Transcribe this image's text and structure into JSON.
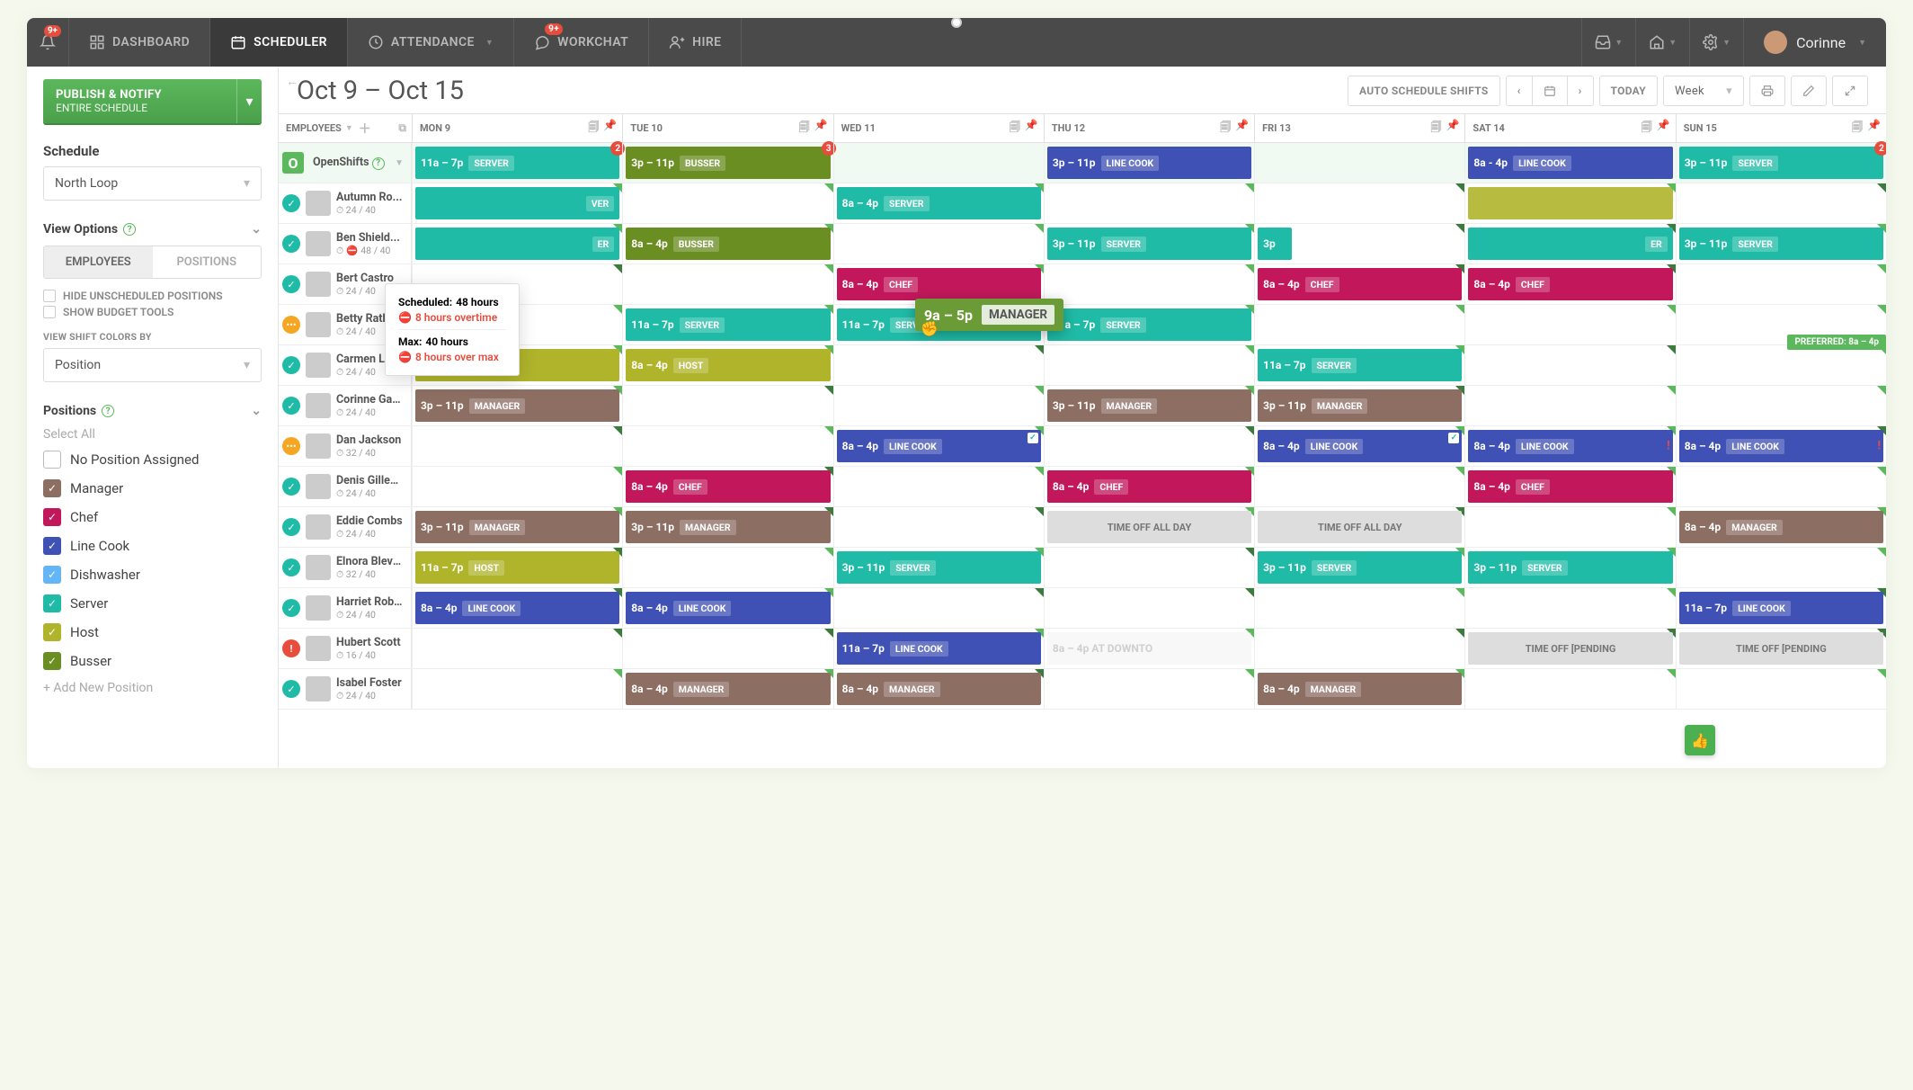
{
  "nav": {
    "notif_badge": "9+",
    "dashboard": "DASHBOARD",
    "scheduler": "SCHEDULER",
    "attendance": "ATTENDANCE",
    "workchat": "WORKCHAT",
    "workchat_badge": "9+",
    "hire": "HIRE",
    "user": "Corinne"
  },
  "sidebar": {
    "publish_title": "PUBLISH & NOTIFY",
    "publish_sub": "ENTIRE SCHEDULE",
    "schedule_label": "Schedule",
    "schedule_value": "North Loop",
    "view_options": "View Options",
    "toggle_a": "EMPLOYEES",
    "toggle_b": "POSITIONS",
    "hide_unscheduled": "HIDE UNSCHEDULED POSITIONS",
    "show_budget": "SHOW BUDGET TOOLS",
    "view_colors_by": "VIEW SHIFT COLORS BY",
    "color_value": "Position",
    "positions_label": "Positions",
    "select_all": "Select All",
    "positions": [
      {
        "label": "No Position Assigned",
        "color": "#fff",
        "border": "#bbb",
        "checked": false
      },
      {
        "label": "Manager",
        "color": "#8d6e63",
        "checked": true
      },
      {
        "label": "Chef",
        "color": "#c2185b",
        "checked": true
      },
      {
        "label": "Line Cook",
        "color": "#3f51b5",
        "checked": true
      },
      {
        "label": "Dishwasher",
        "color": "#64b5f6",
        "checked": true
      },
      {
        "label": "Server",
        "color": "#1fbba6",
        "checked": true
      },
      {
        "label": "Host",
        "color": "#afb42b",
        "checked": true
      },
      {
        "label": "Busser",
        "color": "#6b8e23",
        "checked": true
      }
    ],
    "add_position": "+ Add New Position"
  },
  "toolbar": {
    "date_range": "Oct 9 – Oct 15",
    "auto_schedule": "AUTO SCHEDULE SHIFTS",
    "today": "TODAY",
    "view": "Week"
  },
  "grid": {
    "employees_hdr": "EMPLOYEES",
    "days": [
      "MON 9",
      "TUE 10",
      "WED 11",
      "THU 12",
      "FRI 13",
      "SAT 14",
      "SUN 15"
    ],
    "openshifts_label": "OpenShifts",
    "openshifts": [
      {
        "day": 0,
        "time": "11a – 7p",
        "role": "SERVER",
        "color": "#1fbba6",
        "count": "2"
      },
      {
        "day": 1,
        "time": "3p – 11p",
        "role": "BUSSER",
        "color": "#6b8e23",
        "count": "3"
      },
      {
        "day": 3,
        "time": "3p – 11p",
        "role": "LINE COOK",
        "color": "#3f51b5"
      },
      {
        "day": 5,
        "time": "8a - 4p",
        "role": "LINE COOK",
        "color": "#3f51b5"
      },
      {
        "day": 6,
        "time": "3p – 11p",
        "role": "SERVER",
        "color": "#1fbba6",
        "count": "2"
      }
    ],
    "rows": [
      {
        "name": "Autumn Ro...",
        "hours": "24 / 40",
        "status": "ok",
        "shifts": [
          {
            "day": 0,
            "time": "",
            "role": "VER",
            "color": "#1fbba6",
            "partial": true
          },
          {
            "day": 2,
            "time": "8a – 4p",
            "role": "SERVER",
            "color": "#1fbba6"
          }
        ]
      },
      {
        "name": "Ben Shield...",
        "hours": "48 / 40",
        "status": "ok",
        "warn": true,
        "shifts": [
          {
            "day": 0,
            "time": "",
            "role": "ER",
            "color": "#1fbba6",
            "partial": true
          },
          {
            "day": 1,
            "time": "8a – 4p",
            "role": "BUSSER",
            "color": "#6b8e23"
          },
          {
            "day": 3,
            "time": "3p – 11p",
            "role": "SERVER",
            "color": "#1fbba6"
          },
          {
            "day": 4,
            "time": "3p",
            "role": "",
            "color": "#1fbba6",
            "narrow": true
          },
          {
            "day": 5,
            "time": "",
            "role": "ER",
            "color": "#1fbba6",
            "partial": true
          },
          {
            "day": 6,
            "time": "3p – 11p",
            "role": "SERVER",
            "color": "#1fbba6"
          }
        ]
      },
      {
        "name": "Bert Castro",
        "hours": "24 / 40",
        "status": "ok",
        "shifts": [
          {
            "day": 2,
            "time": "8a – 4p",
            "role": "CHEF",
            "color": "#c2185b"
          },
          {
            "day": 4,
            "time": "8a – 4p",
            "role": "CHEF",
            "color": "#c2185b"
          },
          {
            "day": 5,
            "time": "8a – 4p",
            "role": "CHEF",
            "color": "#c2185b"
          }
        ]
      },
      {
        "name": "Betty Rathmen",
        "hours": "24 / 40",
        "status": "warn",
        "shifts": [
          {
            "day": 1,
            "time": "11a – 7p",
            "role": "SERVER",
            "color": "#1fbba6"
          },
          {
            "day": 2,
            "time": "11a – 7p",
            "role": "SERVER",
            "color": "#1fbba6"
          },
          {
            "day": 3,
            "time": "11a – 7p",
            "role": "SERVER",
            "color": "#1fbba6"
          }
        ]
      },
      {
        "name": "Carmen Lowe",
        "hours": "24 / 40",
        "status": "ok",
        "pref": "PREFERRED: 8a – 4p",
        "shifts": [
          {
            "day": 0,
            "time": "8a – 4p",
            "role": "HOST",
            "color": "#afb42b"
          },
          {
            "day": 1,
            "time": "8a – 4p",
            "role": "HOST",
            "color": "#afb42b"
          },
          {
            "day": 4,
            "time": "11a – 7p",
            "role": "SERVER",
            "color": "#1fbba6"
          }
        ]
      },
      {
        "name": "Corinne Garris...",
        "hours": "24 / 40",
        "status": "ok",
        "shifts": [
          {
            "day": 0,
            "time": "3p – 11p",
            "role": "MANAGER",
            "color": "#8d6e63"
          },
          {
            "day": 3,
            "time": "3p – 11p",
            "role": "MANAGER",
            "color": "#8d6e63"
          },
          {
            "day": 4,
            "time": "3p – 11p",
            "role": "MANAGER",
            "color": "#8d6e63"
          }
        ]
      },
      {
        "name": "Dan Jackson",
        "hours": "32 / 40",
        "status": "warn",
        "shifts": [
          {
            "day": 2,
            "time": "8a – 4p",
            "role": "LINE COOK",
            "color": "#3f51b5",
            "check": true
          },
          {
            "day": 4,
            "time": "8a – 4p",
            "role": "LINE COOK",
            "color": "#3f51b5",
            "check": true
          },
          {
            "day": 5,
            "time": "8a – 4p",
            "role": "LINE COOK",
            "color": "#3f51b5",
            "warnmark": true
          },
          {
            "day": 6,
            "time": "8a – 4p",
            "role": "LINE COOK",
            "color": "#3f51b5",
            "warnmark": true
          }
        ]
      },
      {
        "name": "Denis Gillespie",
        "hours": "24 / 40",
        "status": "ok",
        "shifts": [
          {
            "day": 1,
            "time": "8a – 4p",
            "role": "CHEF",
            "color": "#c2185b"
          },
          {
            "day": 3,
            "time": "8a – 4p",
            "role": "CHEF",
            "color": "#c2185b",
            "hatched": true
          },
          {
            "day": 5,
            "time": "8a – 4p",
            "role": "CHEF",
            "color": "#c2185b",
            "hatched": true
          }
        ]
      },
      {
        "name": "Eddie Combs",
        "hours": "24 / 40",
        "status": "ok",
        "shifts": [
          {
            "day": 0,
            "time": "3p – 11p",
            "role": "MANAGER",
            "color": "#8d6e63"
          },
          {
            "day": 1,
            "time": "3p – 11p",
            "role": "MANAGER",
            "color": "#8d6e63"
          },
          {
            "day": 3,
            "time": "TIME OFF ALL DAY",
            "timeoff": true
          },
          {
            "day": 4,
            "time": "TIME OFF ALL DAY",
            "timeoff": true
          },
          {
            "day": 6,
            "time": "8a – 4p",
            "role": "MANAGER",
            "color": "#8d6e63"
          }
        ]
      },
      {
        "name": "Elnora Blevins",
        "hours": "32 / 40",
        "status": "ok",
        "shifts": [
          {
            "day": 0,
            "time": "11a – 7p",
            "role": "HOST",
            "color": "#afb42b"
          },
          {
            "day": 2,
            "time": "3p – 11p",
            "role": "SERVER",
            "color": "#1fbba6"
          },
          {
            "day": 4,
            "time": "3p – 11p",
            "role": "SERVER",
            "color": "#1fbba6"
          },
          {
            "day": 5,
            "time": "3p – 11p",
            "role": "SERVER",
            "color": "#1fbba6"
          }
        ]
      },
      {
        "name": "Harriet Roberts",
        "hours": "24 / 40",
        "status": "ok",
        "shifts": [
          {
            "day": 0,
            "time": "8a – 4p",
            "role": "LINE COOK",
            "color": "#3f51b5",
            "hatched": true
          },
          {
            "day": 1,
            "time": "8a – 4p",
            "role": "LINE COOK",
            "color": "#3f51b5",
            "hatched": true
          },
          {
            "day": 6,
            "time": "11a – 7p",
            "role": "LINE COOK",
            "color": "#3f51b5"
          }
        ]
      },
      {
        "name": "Hubert Scott",
        "hours": "16 / 40",
        "status": "alert",
        "shifts": [
          {
            "day": 2,
            "time": "11a – 7p",
            "role": "LINE COOK",
            "color": "#3f51b5"
          },
          {
            "day": 3,
            "time": "8a – 4p",
            "role": "AT DOWNTO",
            "faded": true
          },
          {
            "day": 5,
            "time": "TIME OFF [PENDING",
            "timeoff": true
          },
          {
            "day": 6,
            "time": "TIME OFF [PENDING",
            "timeoff": true
          }
        ]
      },
      {
        "name": "Isabel Foster",
        "hours": "24 / 40",
        "status": "ok",
        "shifts": [
          {
            "day": 1,
            "time": "8a – 4p",
            "role": "MANAGER",
            "color": "#8d6e63"
          },
          {
            "day": 2,
            "time": "8a – 4p",
            "role": "MANAGER",
            "color": "#8d6e63"
          },
          {
            "day": 4,
            "time": "8a – 4p",
            "role": "MANAGER",
            "color": "#8d6e63"
          }
        ]
      }
    ]
  },
  "tooltip": {
    "sched_l": "Scheduled:",
    "sched_v": "48 hours",
    "ot": "8 hours overtime",
    "max_l": "Max:",
    "max_v": "40 hours",
    "over": "8 hours over max"
  },
  "drag": {
    "time": "9a – 5p",
    "role": "MANAGER"
  }
}
